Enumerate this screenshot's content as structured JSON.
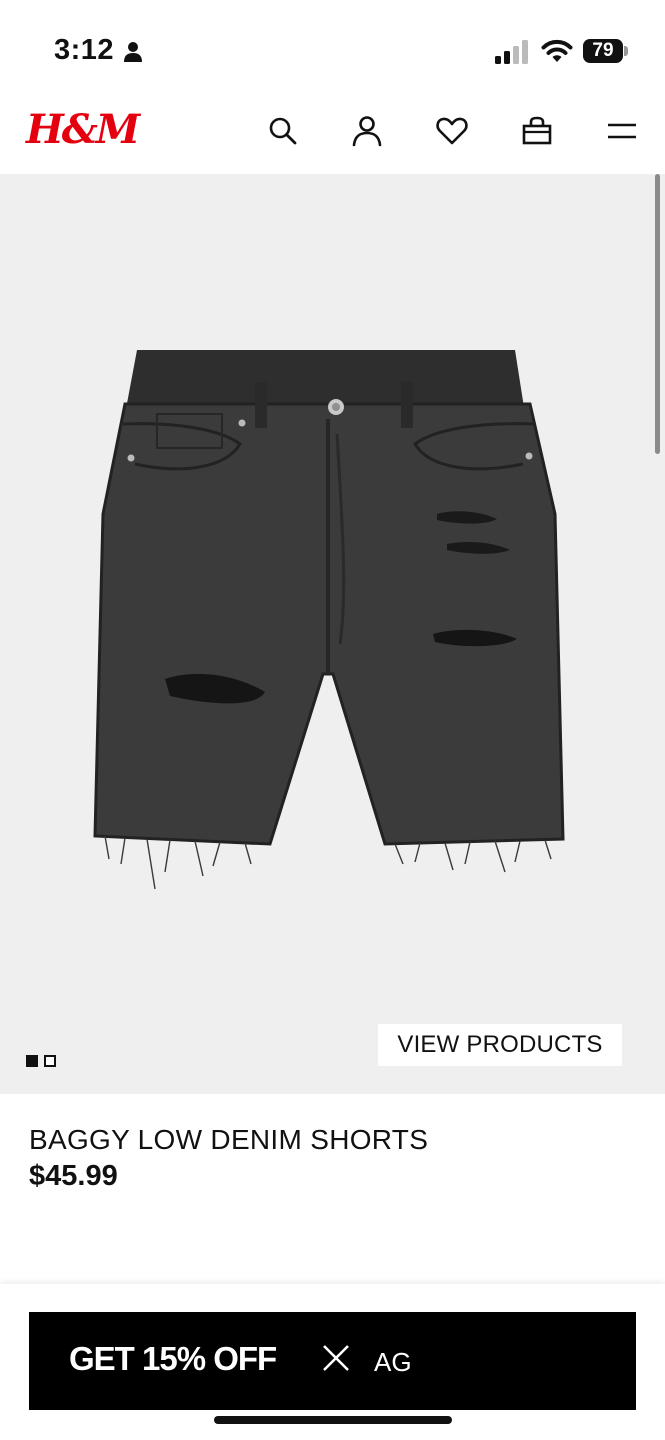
{
  "status_bar": {
    "time": "3:12",
    "battery": "79"
  },
  "header": {
    "logo": "H&M",
    "icons": [
      "search-icon",
      "account-icon",
      "heart-icon",
      "bag-icon",
      "menu-icon"
    ]
  },
  "hero": {
    "image_alt": "black denim shorts",
    "view_products_label": "VIEW PRODUCTS",
    "carousel": {
      "total": 2,
      "active": 1
    }
  },
  "product": {
    "name": "BAGGY LOW DENIM SHORTS",
    "price": "$45.99"
  },
  "promo": {
    "text": "GET 15% OFF",
    "code": "AG"
  },
  "colors": {
    "brand_red": "#e50010",
    "hero_bg": "#efeff0",
    "promo_bg": "#000000"
  }
}
